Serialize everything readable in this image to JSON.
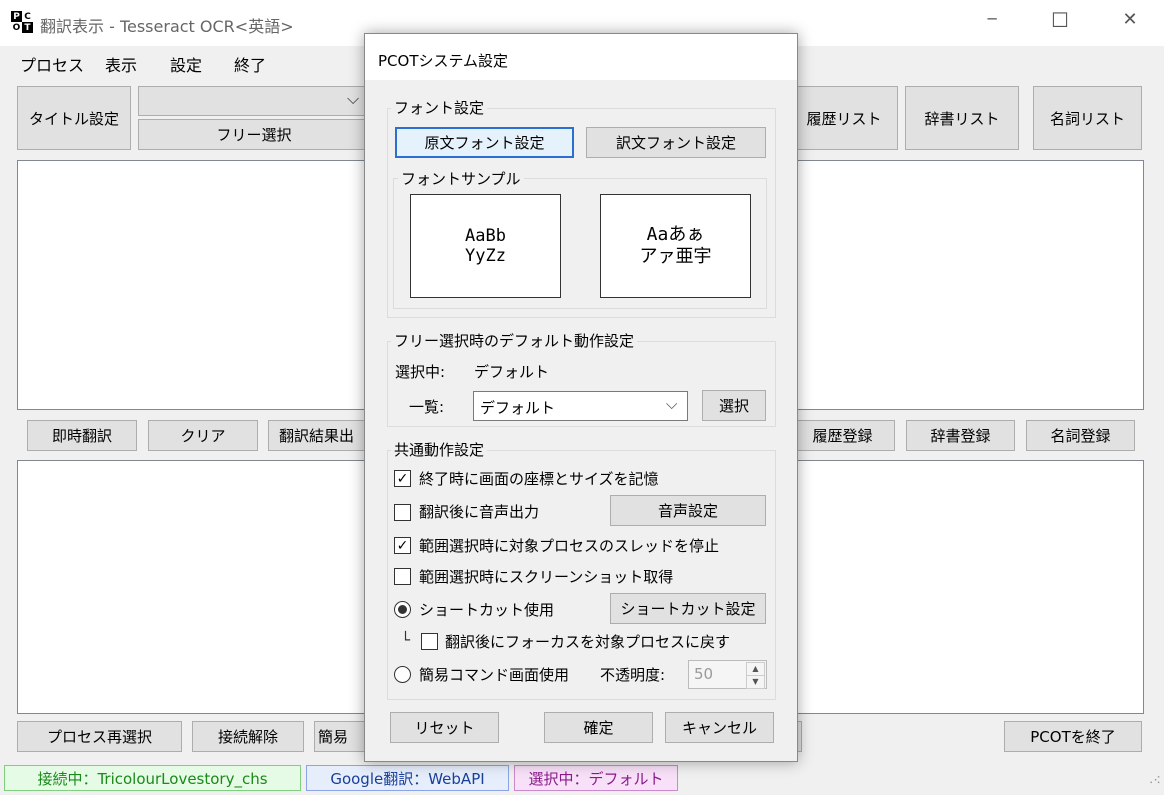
{
  "app": {
    "logo_letters": [
      "P",
      "C",
      "O",
      "T"
    ],
    "title": "翻訳表示 - Tesseract OCR<英語>",
    "window_controls": {
      "minimize": "─",
      "maximize": "☐",
      "close": "✕"
    }
  },
  "menubar": [
    "プロセス",
    "表示",
    "設定",
    "終了"
  ],
  "toolbar": {
    "title_button": "タイトル設定",
    "combo_value": "",
    "free_select": "フリー選択",
    "history_list": "履歴リスト",
    "dict_list": "辞書リスト",
    "noun_list": "名詞リスト"
  },
  "row2": {
    "instant": "即時翻訳",
    "clear": "クリア",
    "result_out": "翻訳結果出",
    "history_reg": "履歴登録",
    "dict_reg": "辞書登録",
    "noun_reg": "名詞登録"
  },
  "bottom": {
    "reselect": "プロセス再選択",
    "disconnect": "接続解除",
    "simple": "簡易",
    "quit": "PCOTを終了"
  },
  "status": {
    "connection": "接続中：TricolourLovestory_chs",
    "translator": "Google翻訳：WebAPI",
    "selection": "選択中：デフォルト",
    "connection_color": "#1a8a1a",
    "translator_color": "#1a3f9a",
    "selection_color": "#8a1a8a"
  },
  "dialog": {
    "title": "PCOTシステム設定",
    "font_group": "フォント設定",
    "orig_font_btn": "原文フォント設定",
    "trans_font_btn": "訳文フォント設定",
    "sample_group": "フォントサンプル",
    "sample1_line1": "AaBb",
    "sample1_line2": "YyZz",
    "sample2_line1": "Aaあぁ",
    "sample2_line2": "アァ亜宇",
    "free_group": "フリー選択時のデフォルト動作設定",
    "selecting_label": "選択中:",
    "selecting_value": "デフォルト",
    "list_label": "一覧:",
    "list_value": "デフォルト",
    "select_btn": "選択",
    "common_group": "共通動作設定",
    "opt_remember": "終了時に画面の座標とサイズを記憶",
    "opt_remember_checked": true,
    "opt_voice": "翻訳後に音声出力",
    "opt_voice_checked": false,
    "voice_btn": "音声設定",
    "opt_stop_thread": "範囲選択時に対象プロセスのスレッドを停止",
    "opt_stop_thread_checked": true,
    "opt_screenshot": "範囲選択時にスクリーンショット取得",
    "opt_screenshot_checked": false,
    "opt_shortcut": "ショートカット使用",
    "opt_shortcut_selected": true,
    "shortcut_btn": "ショートカット設定",
    "tree_glyph": "└",
    "opt_focus_back": "翻訳後にフォーカスを対象プロセスに戻す",
    "opt_focus_back_checked": false,
    "opt_simple_cmd": "簡易コマンド画面使用",
    "opt_simple_cmd_selected": false,
    "opacity_label": "不透明度:",
    "opacity_value": "50",
    "reset_btn": "リセット",
    "ok_btn": "確定",
    "cancel_btn": "キャンセル"
  }
}
